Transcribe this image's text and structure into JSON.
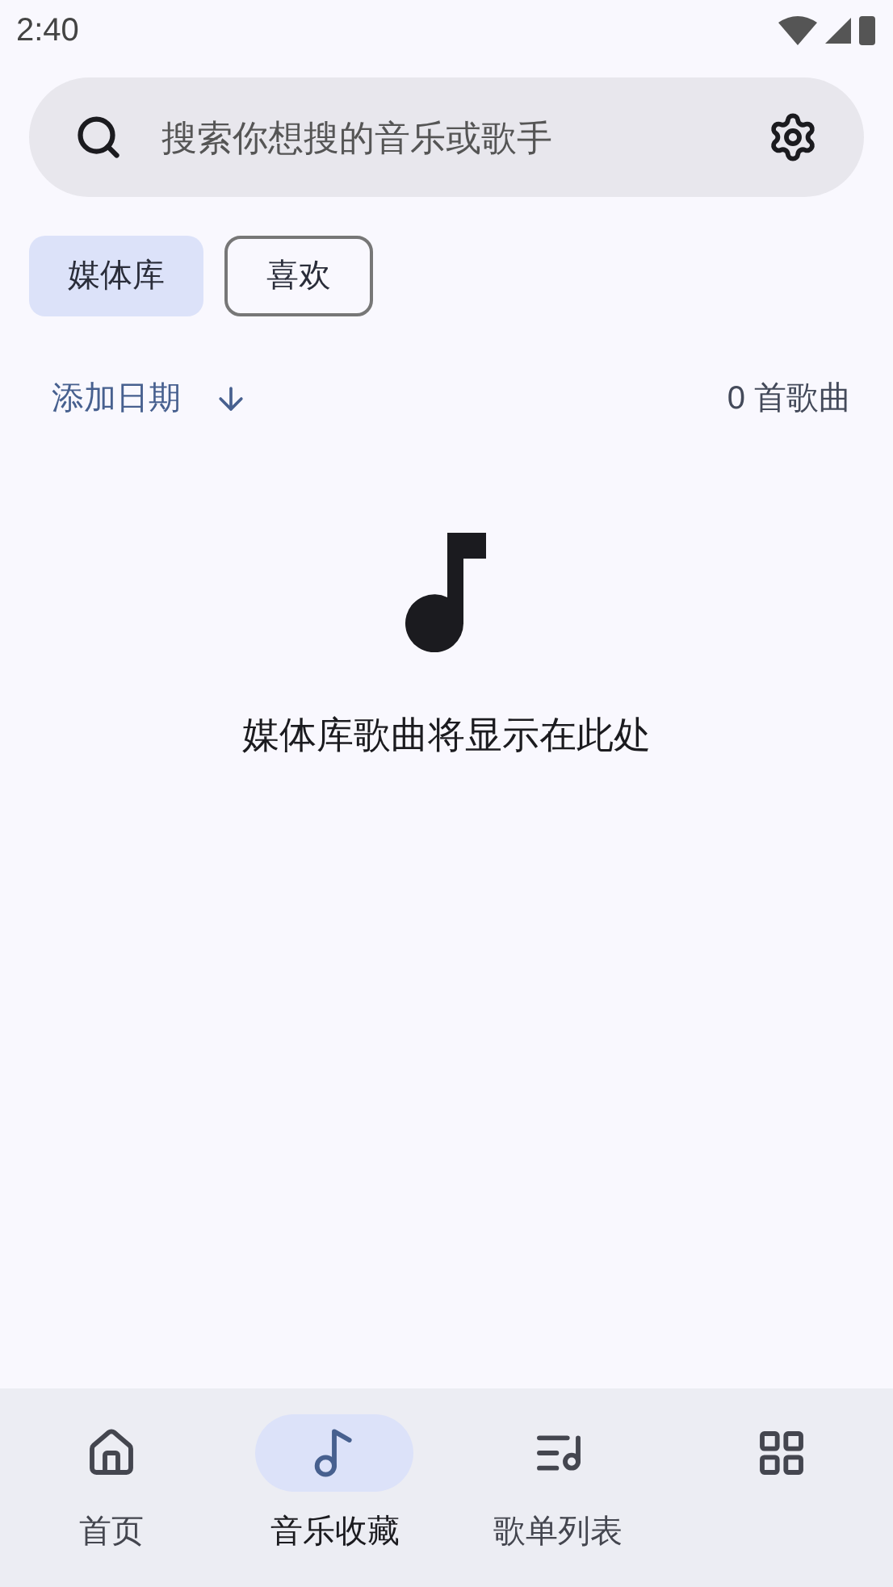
{
  "status_bar": {
    "time": "2:40"
  },
  "search": {
    "placeholder": "搜索你想搜的音乐或歌手"
  },
  "chips": [
    {
      "label": "媒体库",
      "selected": true
    },
    {
      "label": "喜欢",
      "selected": false
    }
  ],
  "sort": {
    "label": "添加日期",
    "count": "0 首歌曲"
  },
  "empty_state": {
    "message": "媒体库歌曲将显示在此处"
  },
  "nav": [
    {
      "kind": "home",
      "label": "首页",
      "selected": false
    },
    {
      "kind": "music",
      "label": "音乐收藏",
      "selected": true
    },
    {
      "kind": "playlist",
      "label": "歌单列表",
      "selected": false
    },
    {
      "kind": "grid",
      "selected": false
    }
  ]
}
